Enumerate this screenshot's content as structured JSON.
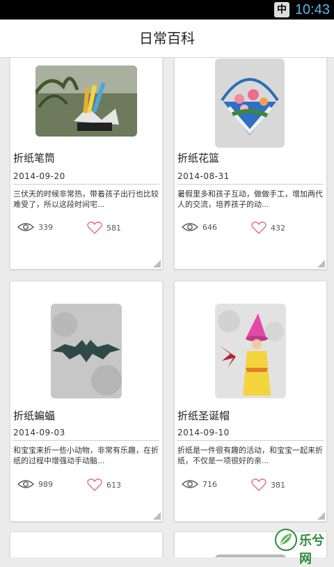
{
  "status_bar": {
    "ime": "中",
    "time": "10:43"
  },
  "app_bar": {
    "title": "日常百科"
  },
  "cards": [
    {
      "title": "折纸笔筒",
      "date": "2014-09-20",
      "desc": "三伏天的时候非常热，带着孩子出行也比较难受了，所以这段时间宅...",
      "views": "339",
      "likes": "581"
    },
    {
      "title": "折纸花篮",
      "date": "2014-08-31",
      "desc": "暑假里多和孩子互动，做做手工，增加两代人的交流，培养孩子的动...",
      "views": "646",
      "likes": "432"
    },
    {
      "title": "折纸蝙蝠",
      "date": "2014-09-03",
      "desc": "和宝宝来折一些小动物，非常有乐趣，在折纸的过程中增强动手动脑...",
      "views": "989",
      "likes": "613"
    },
    {
      "title": "折纸圣诞帽",
      "date": "2014-09-10",
      "desc": "折纸是一件很有趣的活动，和宝宝一起来折纸，不仅是一项很好的亲...",
      "views": "716",
      "likes": "381"
    }
  ],
  "watermark": {
    "text": "乐兮网"
  },
  "colors": {
    "heart": "#e06c7a",
    "eye": "#555555",
    "clock": "#5ab4e8"
  }
}
